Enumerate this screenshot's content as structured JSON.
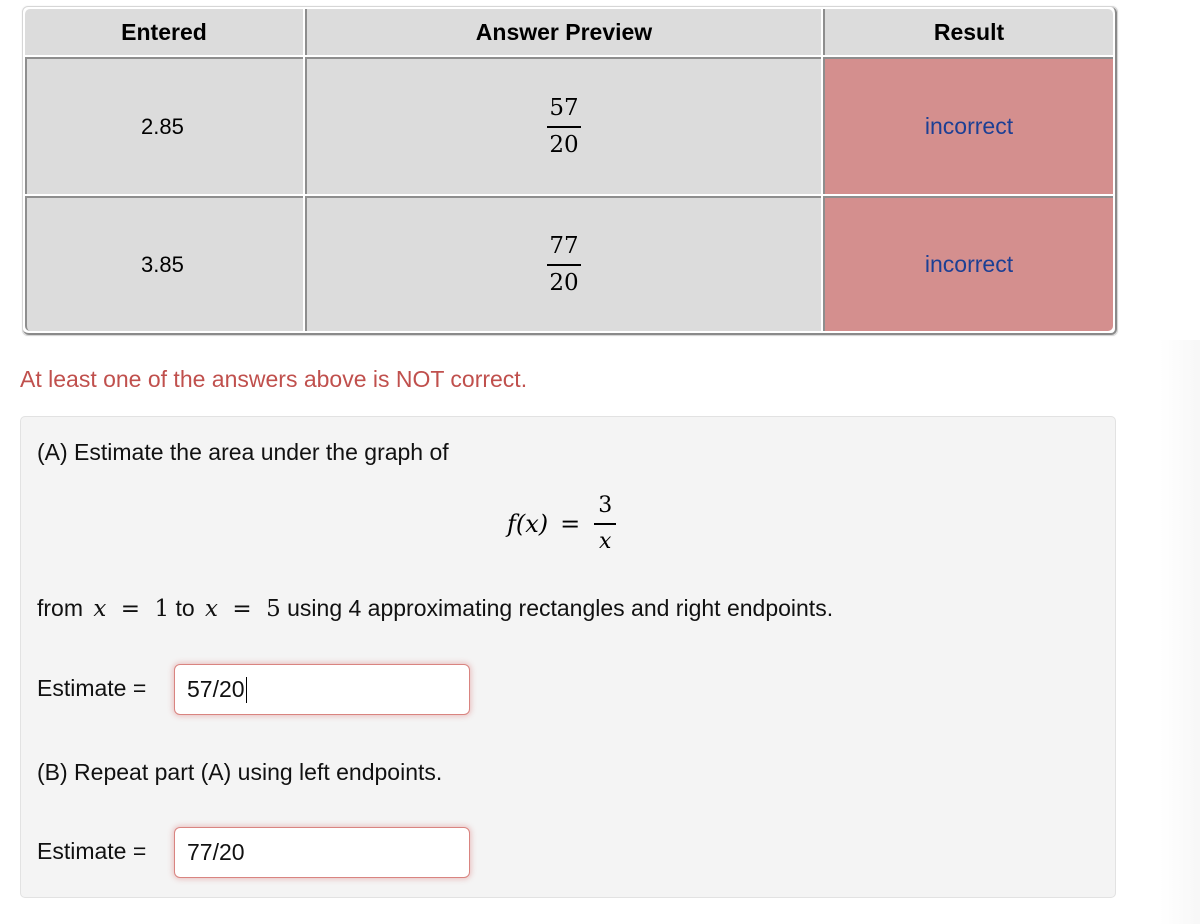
{
  "results_table": {
    "headers": [
      "Entered",
      "Answer Preview",
      "Result"
    ],
    "rows": [
      {
        "entered": "2.85",
        "preview": {
          "numerator": "57",
          "denominator": "20"
        },
        "result": "incorrect"
      },
      {
        "entered": "3.85",
        "preview": {
          "numerator": "77",
          "denominator": "20"
        },
        "result": "incorrect"
      }
    ],
    "colors": {
      "cell_bg": "#dcdcdc",
      "incorrect_bg": "#d48f8e",
      "result_text": "#1c3f94"
    }
  },
  "error_message": "At least one of the answers above is NOT correct.",
  "error_color": "#c0504d",
  "problem": {
    "part_a_intro": "(A) Estimate the area under the graph of",
    "function": {
      "lhs": "f(x)",
      "equals": "=",
      "numerator": "3",
      "denominator": "x"
    },
    "range_text": {
      "from": "from",
      "x1_var": "x",
      "x1_eq": "=",
      "x1_val": "1",
      "to": "to",
      "x2_var": "x",
      "x2_eq": "=",
      "x2_val": "5",
      "rest": "using 4 approximating rectangles and right endpoints."
    },
    "part_a_label": "Estimate =",
    "part_a_value": "57/20",
    "part_b_intro": "(B) Repeat part (A) using left endpoints.",
    "part_b_label": "Estimate =",
    "part_b_value": "77/20"
  }
}
